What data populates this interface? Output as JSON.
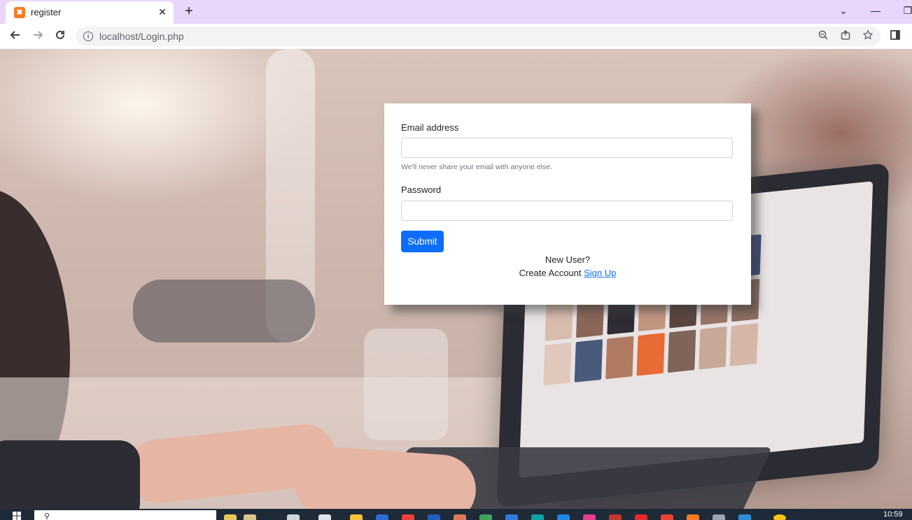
{
  "browser": {
    "tab_title": "register",
    "tab_close": "✕",
    "new_tab": "+",
    "url": "localhost/Login.php",
    "window_controls": {
      "dropdown": "⌄",
      "minimize": "—",
      "restore": "❐"
    },
    "icons": [
      "back-icon",
      "forward-icon",
      "reload-icon",
      "info-icon",
      "zoom-icon",
      "share-icon",
      "star-icon",
      "side-panel-icon"
    ]
  },
  "form": {
    "email_label": "Email address",
    "email_value": "",
    "email_help": "We'll never share your email with anyone else.",
    "password_label": "Password",
    "password_value": "",
    "submit_label": "Submit",
    "new_user_text": "New User?",
    "create_account_text": "Create Account",
    "signup_link": "Sign Up"
  },
  "taskbar": {
    "clock": "10:59"
  },
  "colors": {
    "tab_strip": "#ebd6fb",
    "primary_button": "#0d6efd",
    "link": "#0d6efd",
    "taskbar": "#1e2a38"
  }
}
